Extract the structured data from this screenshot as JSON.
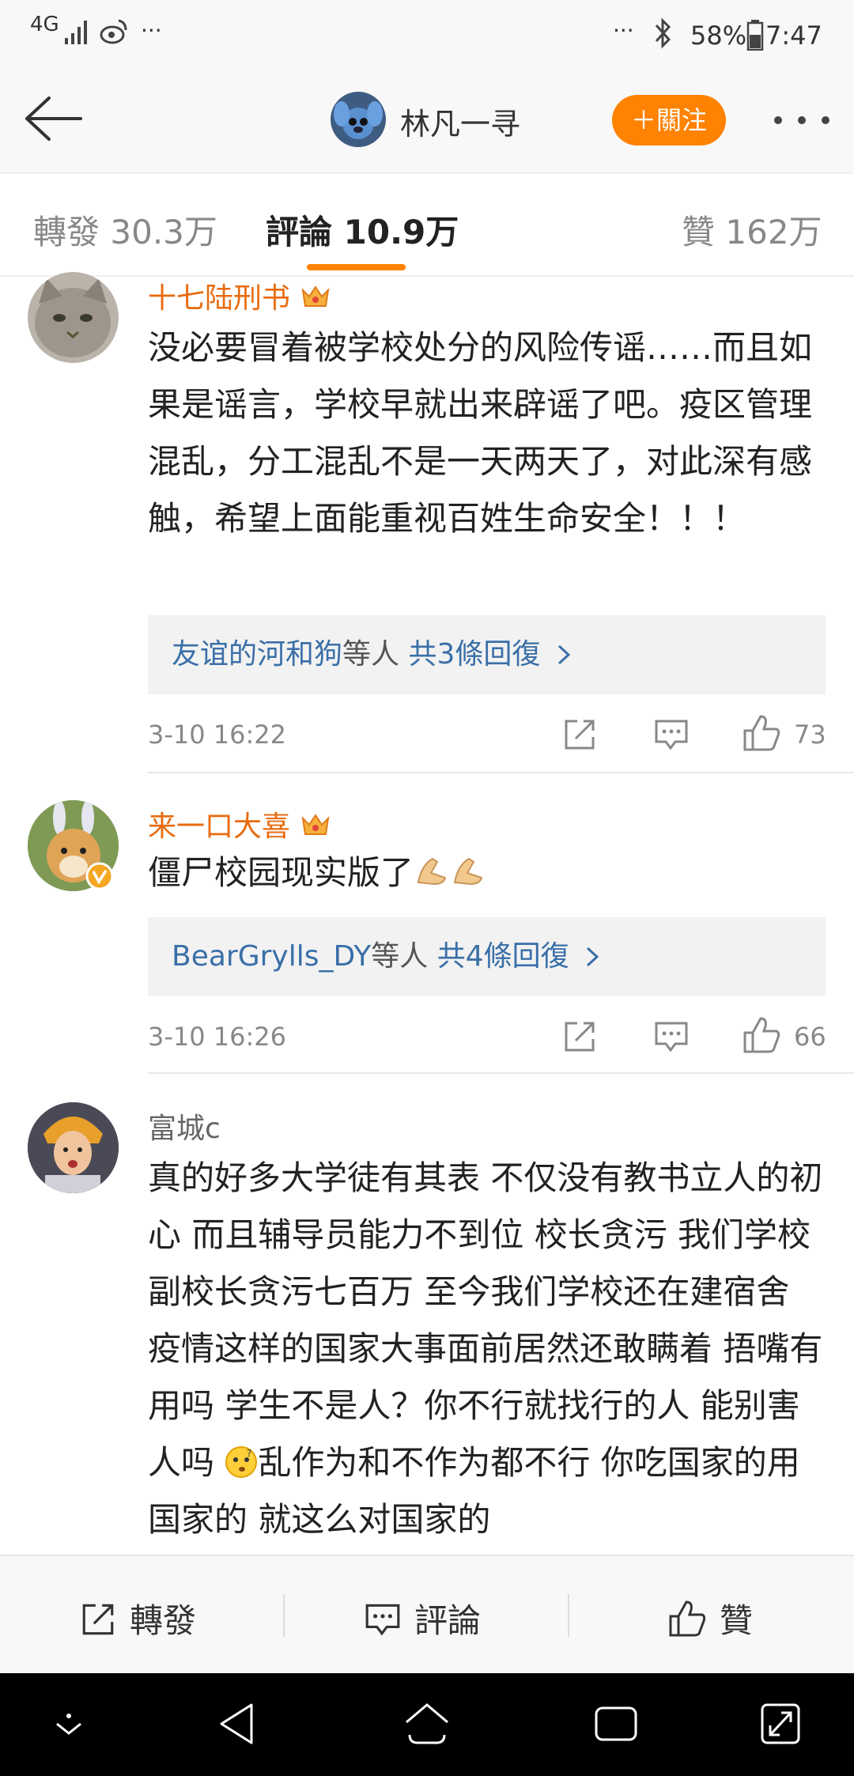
{
  "status": {
    "network": "4G",
    "left_dots": "···",
    "right_dots": "···",
    "battery": "58%",
    "time": "7:47"
  },
  "header": {
    "back_icon": "back-arrow-icon",
    "username": "林凡一寻",
    "follow_label": "＋關注",
    "more_icon": "more-dots-icon",
    "accent": "#ff8200"
  },
  "tabs": [
    {
      "label": "轉發",
      "count": "30.3万"
    },
    {
      "label": "評論",
      "count": "10.9万"
    },
    {
      "label": "贊",
      "count": "162万"
    }
  ],
  "comments": [
    {
      "user": "十七陆刑书",
      "text": "没必要冒着被学校处分的风险传谣……而且如果是谣言，学校早就出来辟谣了吧。疫区管理混乱，分工混乱不是一天两天了，对此深有感触，希望上面能重视百姓生命安全！！！",
      "reply_users": "友谊的河和狗",
      "reply_mid": "等人",
      "reply_count": "共3條回復",
      "time": "3-10 16:22",
      "likes": "73"
    },
    {
      "user": "来一口大喜",
      "text": "僵尸校园现实版了",
      "reply_users": "BearGrylls_DY",
      "reply_mid": "等人",
      "reply_count": "共4條回復",
      "time": "3-10 16:26",
      "likes": "66"
    },
    {
      "user": "富城c",
      "text_before_emoji": "真的好多大学徒有其表 不仅没有教书立人的初心 而且辅导员能力不到位 校长贪污 我们学校副校长贪污七百万 至今我们学校还在建宿舍 疫情这样的国家大事面前居然还敢瞒着 捂嘴有用吗 学生不是人？你不行就找行的人 能别害人吗 ",
      "text_after_emoji": "乱作为和不作为都不行 你吃国家的用国家的 就这么对国家的"
    }
  ],
  "bottom_bar": {
    "repost": "轉發",
    "comment": "評論",
    "like": "贊"
  }
}
